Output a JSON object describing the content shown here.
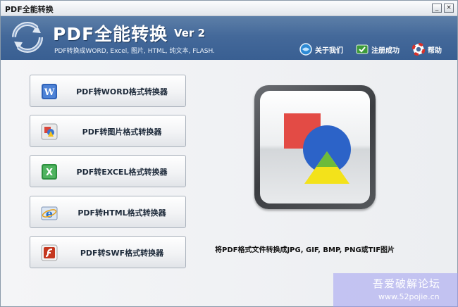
{
  "window": {
    "title": "PDF全能转换"
  },
  "window_controls": {
    "minimize": "_",
    "close": "×"
  },
  "banner": {
    "app_name": "PDF全能转换",
    "version": "Ver 2",
    "tagline": "PDF转换成WORD, Excel, 图片, HTML, 纯文本, FLASH."
  },
  "toplinks": {
    "about": "关于我们",
    "register": "注册成功",
    "help": "帮助"
  },
  "buttons": [
    {
      "label": "PDF转WORD格式转换器",
      "icon": "word-icon",
      "color": "#2f62b8"
    },
    {
      "label": "PDF转图片格式转换器",
      "icon": "picture-icon",
      "color": "#c94b3a"
    },
    {
      "label": "PDF转EXCEL格式转换器",
      "icon": "excel-icon",
      "color": "#2c8f3e"
    },
    {
      "label": "PDF转HTML格式转换器",
      "icon": "ie-icon",
      "color": "#2a70c8"
    },
    {
      "label": "PDF转SWF格式转换器",
      "icon": "flash-icon",
      "color": "#b8321f"
    }
  ],
  "preview": {
    "description": "将PDF格式文件转换成JPG, GIF, BMP, PNG或TIF图片"
  },
  "watermark": {
    "line1": "吾爱破解论坛",
    "line2": "www.52pojie.cn"
  }
}
